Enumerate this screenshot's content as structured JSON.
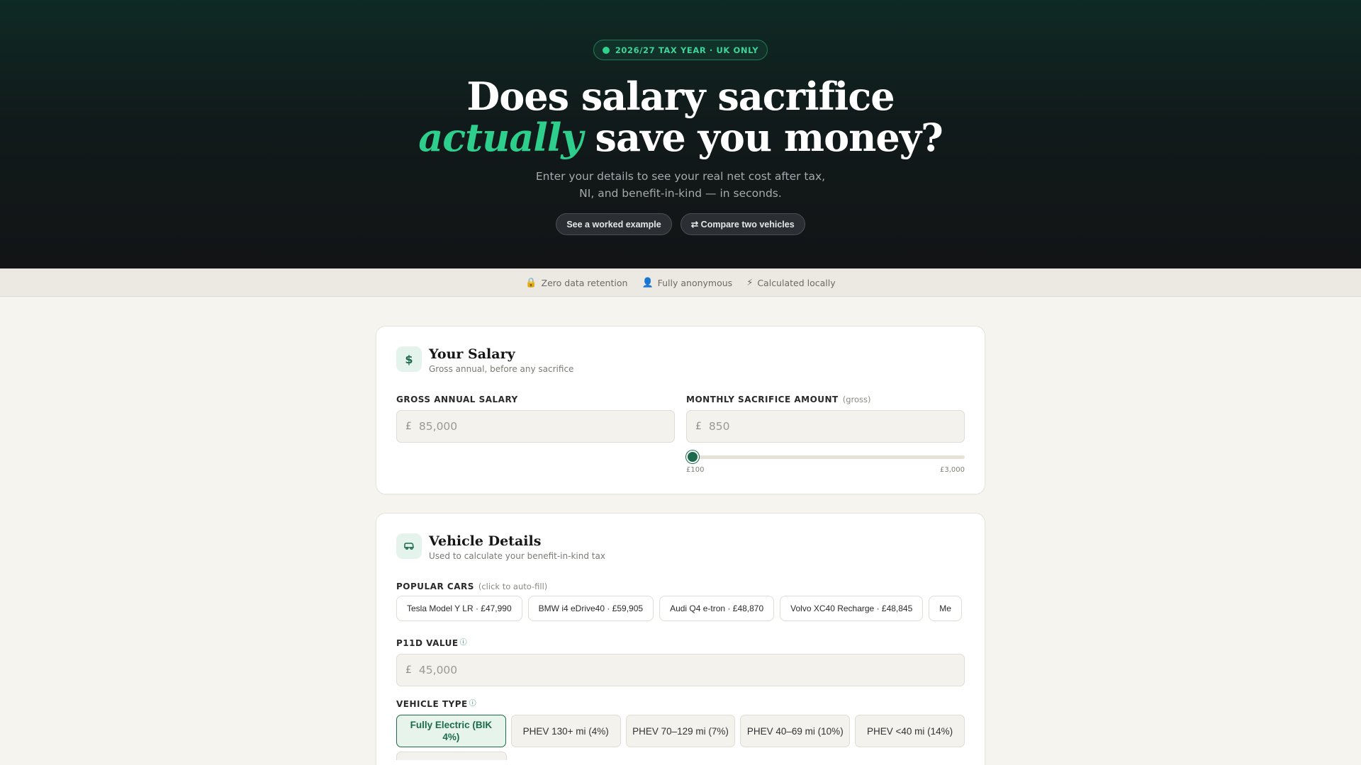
{
  "hero": {
    "badge": "2026/27 TAX YEAR · UK ONLY",
    "headline_line1": "Does salary sacrifice",
    "headline_accent": "actually",
    "headline_line2_rest": "save you money?",
    "subtext": "Enter your details to see your real net cost after tax, NI, and benefit-in-kind — in seconds.",
    "worked_example_label": "See a worked example",
    "compare_label": "⇄ Compare two vehicles"
  },
  "trust": [
    {
      "icon": "🔒",
      "label": "Zero data retention"
    },
    {
      "icon": "👤",
      "label": "Fully anonymous"
    },
    {
      "icon": "⚡",
      "label": "Calculated locally"
    }
  ],
  "salary_card": {
    "icon": "$",
    "title": "Your Salary",
    "subtitle": "Gross annual, before any sacrifice",
    "gross_label": "GROSS ANNUAL SALARY",
    "gross_currency": "£",
    "gross_placeholder": "85,000",
    "monthly_label": "MONTHLY SACRIFICE AMOUNT",
    "monthly_hint": "(gross)",
    "monthly_currency": "£",
    "monthly_placeholder": "850",
    "slider_min_label": "£100",
    "slider_max_label": "£3,000",
    "slider_fraction": 0.0
  },
  "vehicle_card": {
    "title": "Vehicle Details",
    "subtitle": "Used to calculate your benefit-in-kind tax",
    "popular_label": "POPULAR CARS",
    "popular_hint": "(click to auto-fill)",
    "popular_cars": [
      "Tesla Model Y LR · £47,990",
      "BMW i4 eDrive40 · £59,905",
      "Audi Q4 e-tron · £48,870",
      "Volvo XC40 Recharge · £48,845",
      "Me"
    ],
    "p11d_label": "P11D VALUE",
    "p11d_currency": "£",
    "p11d_placeholder": "45,000",
    "type_label": "VEHICLE TYPE",
    "types": [
      "Fully Electric (BIK 4%)",
      "PHEV 130+ mi (4%)",
      "PHEV 70–129 mi (7%)",
      "PHEV 40–69 mi (10%)",
      "PHEV <40 mi (14%)"
    ],
    "selected_type_index": 0
  },
  "colors": {
    "accent_green": "#2ecf8c",
    "dark_green": "#1c6b4c",
    "hero_bg": "#121416"
  }
}
